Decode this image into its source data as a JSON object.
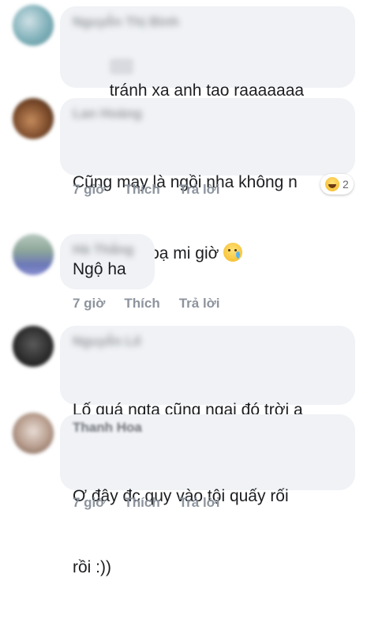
{
  "comments": [
    {
      "author": "Nguyễn Thị Bình",
      "text_line1": "tránh xa anh tao raaaaaaa",
      "time": "",
      "like": "",
      "reply": ""
    },
    {
      "author": "Lan Hoàng",
      "text_line1": "Cũng may là ngồi nha không n",
      "text_line2": "bóp chết hoạ mi giờ",
      "time": "7 giờ",
      "like": "Thích",
      "reply": "Trả lời",
      "reaction_count": "2"
    },
    {
      "author": "Hà Thắng",
      "text_line1": "Ngộ ha",
      "time": "7 giờ",
      "like": "Thích",
      "reply": "Trả lời"
    },
    {
      "author": "Nguyễn Lê",
      "text_line1": "Lố quá ngta cũng ngại đó trời ạ",
      "time": "",
      "like": "",
      "reply": ""
    },
    {
      "author": "Thanh Hoa",
      "text_line1": "Ơ đây đc quy vào tội quấy rối",
      "text_line2": "rồi :))",
      "time": "7 giờ",
      "like": "Thích",
      "reply": "Trả lời"
    }
  ],
  "icons": {
    "angry": "angry-emoji-icon",
    "cry": "crying-face-icon",
    "smile": "smiling-face-icon",
    "laugh": "laugh-reaction-icon"
  },
  "colors": {
    "bubble": "#f0f2f5",
    "action_text": "#8d949e",
    "comment_text": "#1c1e21"
  }
}
